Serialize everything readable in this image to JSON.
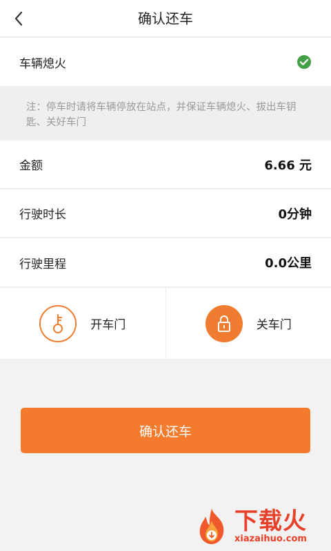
{
  "header": {
    "title": "确认还车",
    "back_icon": "chevron-left-icon"
  },
  "engine": {
    "label": "车辆熄火",
    "status_icon": "check-circle-icon",
    "status_color": "#43a047"
  },
  "note": {
    "text": "注：停车时请将车辆停放在站点，并保证车辆熄火、拔出车钥匙、关好车门"
  },
  "details": {
    "amount": {
      "label": "金额",
      "value": "6.66 元"
    },
    "duration": {
      "label": "行驶时长",
      "value": "0分钟"
    },
    "mileage": {
      "label": "行驶里程",
      "value": "0.0公里"
    }
  },
  "doors": {
    "open": {
      "label": "开车门",
      "icon": "key-icon"
    },
    "close": {
      "label": "关车门",
      "icon": "lock-icon"
    }
  },
  "confirm": {
    "label": "确认还车"
  },
  "watermark": {
    "cn": "下载火",
    "en": "xiazaihuo.com"
  },
  "colors": {
    "accent": "#f47b2d",
    "background": "#f2f2f2"
  }
}
